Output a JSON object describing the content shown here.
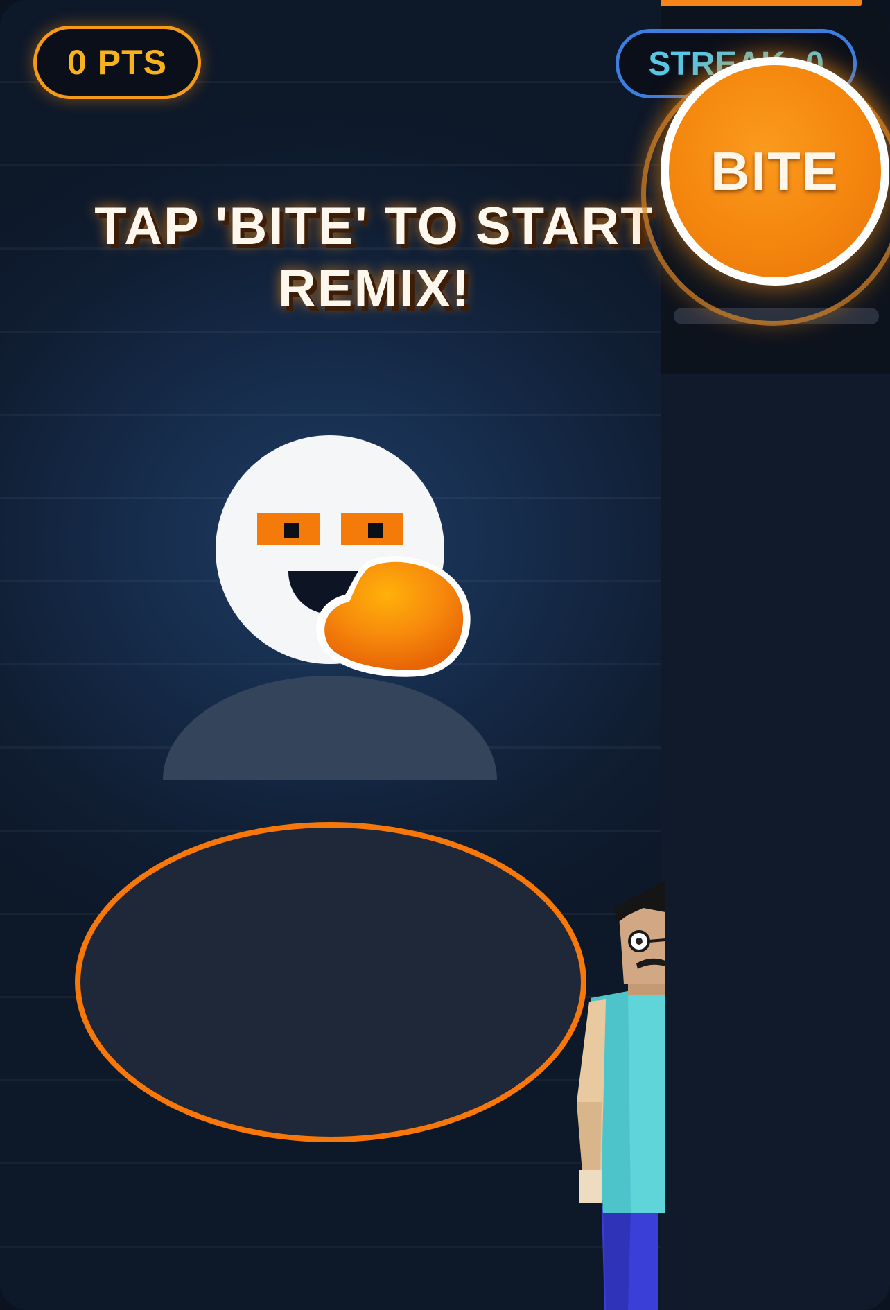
{
  "hud": {
    "score": "0 PTS",
    "streak": "STREAK: 0"
  },
  "controls": {
    "bite_label": "BITE"
  },
  "prompt": {
    "line1": "TAP 'BITE' TO START",
    "line2": "REMIX!"
  },
  "colors": {
    "accent_orange": "#f7851a",
    "score_text": "#f8b31c",
    "streak_border": "#3b7ee0",
    "streak_text": "#58c7e4",
    "face": "#f5f6f8",
    "target_ring": "#f7770a"
  },
  "icons": {
    "character": "smiley-face-icon",
    "food": "orange-blob-icon",
    "player": "blocky-man-icon"
  }
}
